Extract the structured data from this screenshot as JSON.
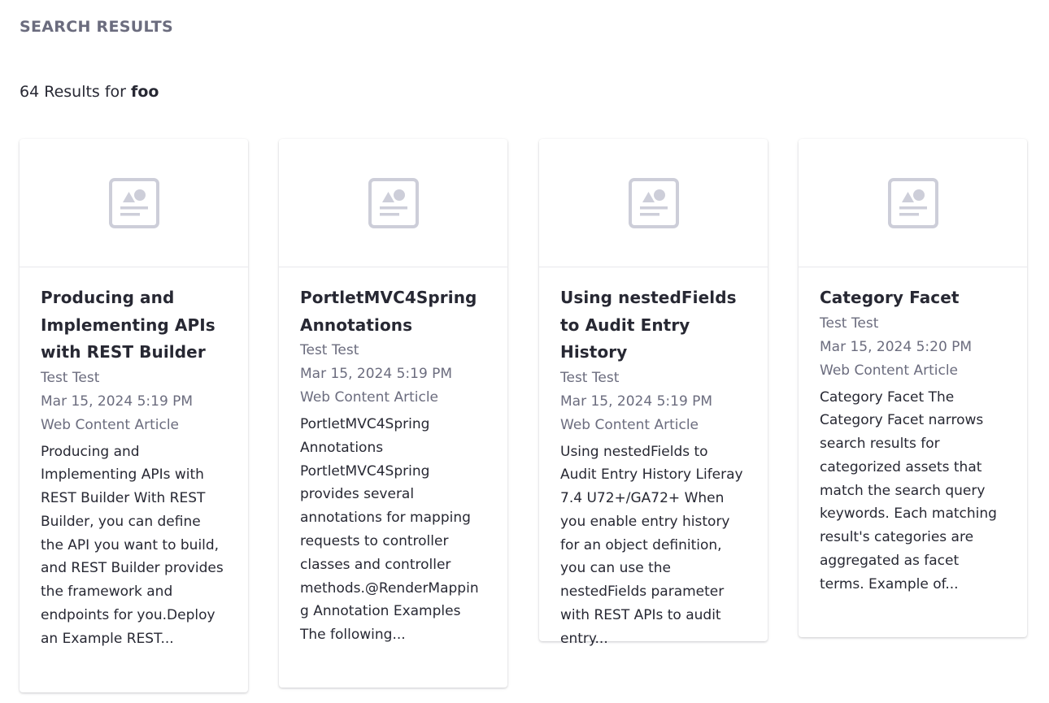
{
  "header": {
    "section_title": "SEARCH RESULTS",
    "results_count_text": "64 Results for",
    "keyword": "foo"
  },
  "results": [
    {
      "title": "Producing and Implementing APIs with REST Builder",
      "author": "Test Test",
      "date": "Mar 15, 2024 5:19 PM",
      "type": "Web Content Article",
      "description": "Producing and Implementing APIs with REST Builder With REST Builder, you can define the API you want to build, and REST Builder provides the framework and endpoints for you.Deploy an Example REST..."
    },
    {
      "title": "PortletMVC4Spring Annotations",
      "author": "Test Test",
      "date": "Mar 15, 2024 5:19 PM",
      "type": "Web Content Article",
      "description": "PortletMVC4Spring Annotations PortletMVC4Spring provides several annotations for mapping requests to controller classes and controller methods.@RenderMapping Annotation Examples The following..."
    },
    {
      "title": "Using nestedFields to Audit Entry History",
      "author": "Test Test",
      "date": "Mar 15, 2024 5:19 PM",
      "type": "Web Content Article",
      "description": "Using nestedFields to Audit Entry History Liferay 7.4 U72+/GA72+ When you enable entry history for an object definition, you can use the nestedFields parameter with REST APIs to audit entry..."
    },
    {
      "title": "Category Facet",
      "author": "Test Test",
      "date": "Mar 15, 2024 5:20 PM",
      "type": "Web Content Article",
      "description": "Category Facet The Category Facet narrows search results for categorized assets that match the search query keywords. Each matching result's categories are aggregated as facet terms. Example of..."
    }
  ],
  "placeholder_icon": {
    "name": "web-content-placeholder-icon",
    "color": "#cdced9"
  }
}
